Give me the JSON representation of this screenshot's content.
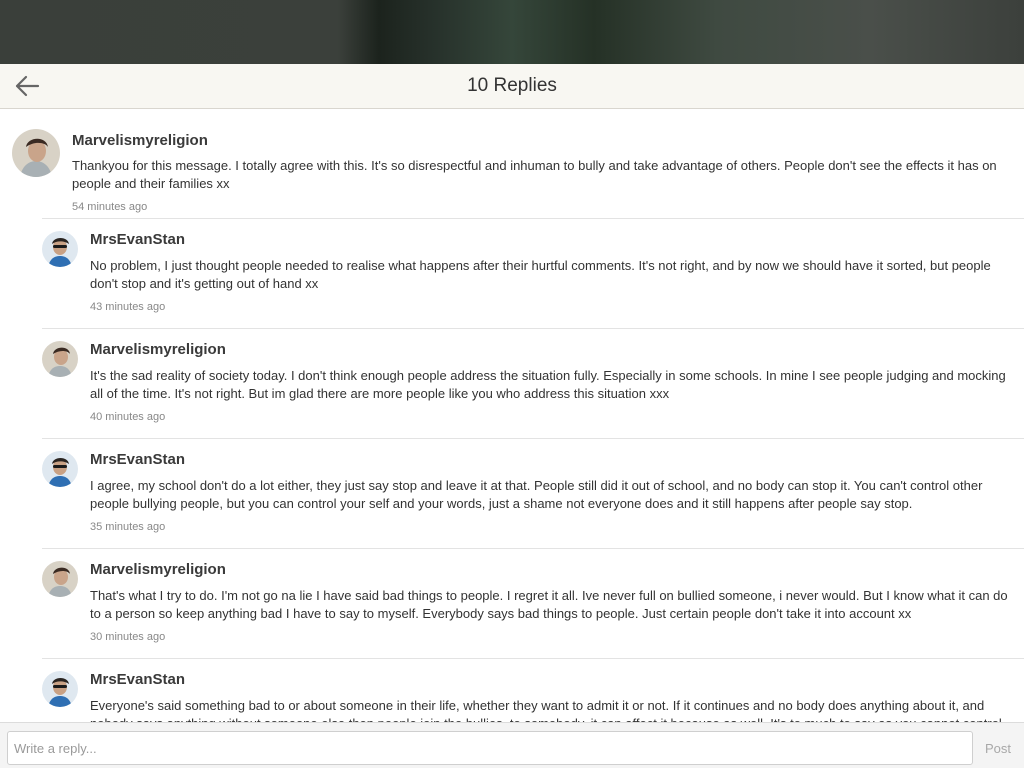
{
  "header": {
    "title": "10 Replies",
    "back_icon": "arrow-left-icon"
  },
  "parent_comment": {
    "username": "Marvelismyreligion",
    "text": "Thankyou for this message. I totally agree with this. It's so disrespectful and inhuman to bully and take advantage of others. People don't see the effects it has on people and their families xx",
    "time": "54 minutes ago"
  },
  "replies": [
    {
      "username": "MrsEvanStan",
      "text": "No problem, I just thought people needed to realise what happens after their hurtful comments. It's not right, and by now we should have it sorted, but people don't stop and it's getting out of hand xx",
      "time": "43 minutes ago"
    },
    {
      "username": "Marvelismyreligion",
      "text": "It's the sad reality of society today. I don't think enough people address the situation fully. Especially in some schools. In mine I see people judging and mocking all of the time. It's not right. But im glad there are more people like you who address this situation xxx",
      "time": "40 minutes ago"
    },
    {
      "username": "MrsEvanStan",
      "text": "I agree, my school don't do a lot either, they just say stop and leave it at that. People still did it out of school, and no body can stop it. You can't control other people bullying people, but you can control your self and your words, just a shame not everyone does and it still happens after people say stop.",
      "time": "35 minutes ago"
    },
    {
      "username": "Marvelismyreligion",
      "text": "That's what I try to do. I'm not go na lie I have said bad things to people. I regret it all. Ive never full on bullied someone, i never would. But I know what it can do to a person so keep anything bad I have to say to myself. Everybody says bad things to people. Just certain people don't take it into account xx",
      "time": "30 minutes ago"
    },
    {
      "username": "MrsEvanStan",
      "text": "Everyone's said something bad to or about someone in their life, whether they want to admit it or not. If it continues and no body does anything about it, and nobody says anything without someone else then people join the bullies, to somebody, it can affect it because as well. It's to much to say as you cannot control",
      "time": ""
    }
  ],
  "composer": {
    "placeholder": "Write a reply...",
    "post_label": "Post"
  }
}
